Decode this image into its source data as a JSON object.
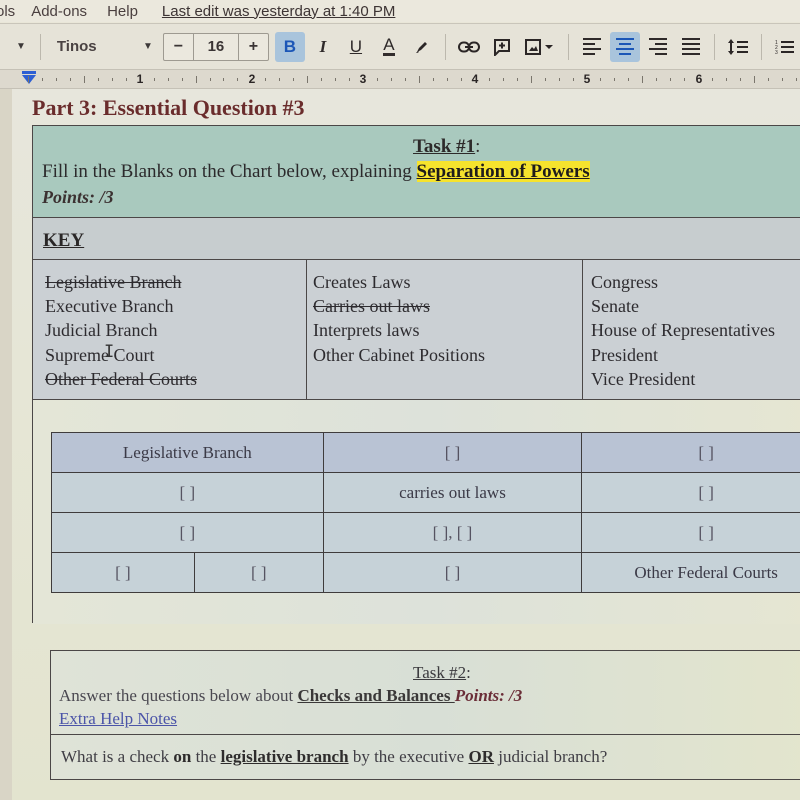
{
  "menubar": {
    "items": [
      "ols",
      "Add-ons",
      "Help"
    ],
    "last_edit": "Last edit was yesterday at 1:40 PM"
  },
  "toolbar": {
    "font_name": "Tinos",
    "font_size": "16",
    "size_minus": "−",
    "size_plus": "+",
    "bold": "B",
    "italic": "I",
    "underline": "U",
    "text_color": "A",
    "bold_active": true,
    "align_active": "center",
    "icons": [
      "style-dropdown-icon",
      "font-dropdown-icon",
      "highlight-pen-icon",
      "link-icon",
      "add-comment-icon",
      "insert-image-icon",
      "align-left-icon",
      "align-center-icon",
      "align-right-icon",
      "align-justify-icon",
      "line-spacing-icon",
      "numbered-list-icon"
    ]
  },
  "ruler": {
    "numbers": [
      "1",
      "2",
      "3",
      "4",
      "5",
      "6"
    ]
  },
  "document": {
    "part_title": "Part 3: Essential Question #3",
    "task1": {
      "title": "Task #1",
      "title_suffix": ":",
      "instruction_prefix": "Fill in the Blanks on the Chart below, explaining ",
      "instruction_highlight": "Separation of Powers",
      "points": "Points: /3",
      "highlight_color": "#f6e32d"
    },
    "key": {
      "label": "KEY",
      "columns": [
        [
          {
            "text": "Legislative Branch",
            "struck": true
          },
          {
            "text": "Executive Branch",
            "struck": false
          },
          {
            "text": "Judicial Branch",
            "struck": false
          },
          {
            "text": "Supreme Court",
            "struck": false
          },
          {
            "text": "Other Federal Courts",
            "struck": true
          }
        ],
        [
          {
            "text": "Creates Laws",
            "struck": false
          },
          {
            "text": "Carries out laws",
            "struck": true
          },
          {
            "text": "Interprets laws",
            "struck": false
          },
          {
            "text": "Other Cabinet Positions",
            "struck": false
          }
        ],
        [
          {
            "text": "Congress",
            "struck": false
          },
          {
            "text": "Senate",
            "struck": false
          },
          {
            "text": "House of Representatives",
            "struck": false
          },
          {
            "text": "President",
            "struck": false
          },
          {
            "text": "Vice President",
            "struck": false
          }
        ]
      ]
    },
    "chart": {
      "rows": [
        [
          "Legislative Branch",
          "[        ]",
          "[        ]"
        ],
        [
          "[        ]",
          "carries out laws",
          "[        ]"
        ],
        [
          "[        ]",
          "[        ], [        ]",
          "[        ]"
        ],
        [
          "[        ]",
          "[        ]",
          "[        ]",
          "Other Federal Courts"
        ]
      ]
    },
    "task2": {
      "title": "Task #2",
      "title_suffix": ":",
      "instruction_prefix": "Answer the questions below about ",
      "instruction_bold": "Checks and Balances ",
      "points": "Points: /3",
      "help_link": "Extra Help Notes",
      "question": {
        "p1": "What is a check ",
        "p2": "on",
        "p3": " the ",
        "p4": "legislative branch",
        "p5": " by the executive ",
        "p6": "OR",
        "p7": " judicial branch?"
      }
    }
  }
}
